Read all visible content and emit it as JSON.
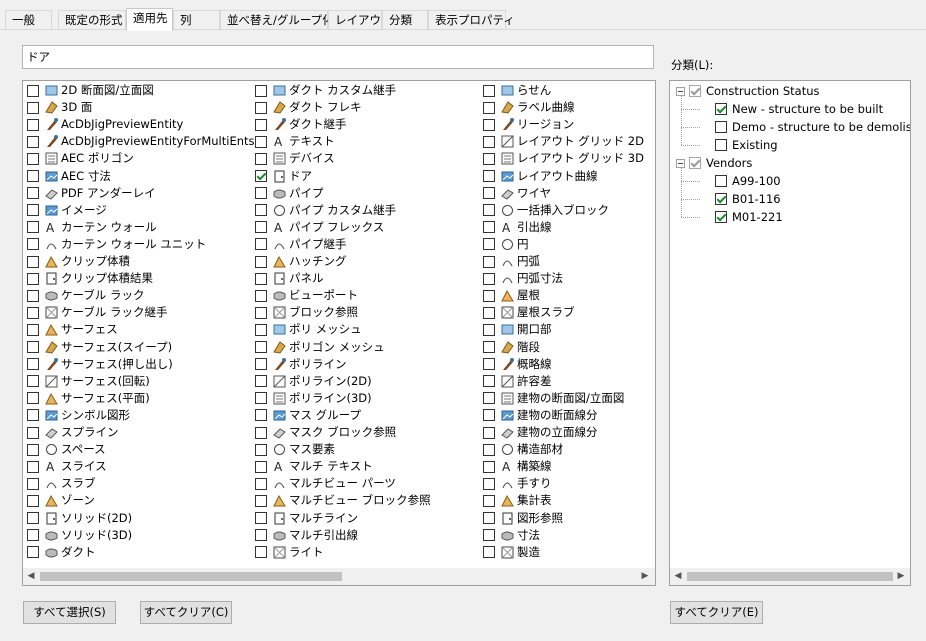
{
  "tabs": [
    "一般",
    "既定の形式",
    "適用先",
    "列",
    "並べ替え/グループ化",
    "レイアウト",
    "分類",
    "表示プロパティ"
  ],
  "active_tab": 2,
  "search": {
    "value": "ドア"
  },
  "columns": [
    [
      {
        "label": "2D 断面図/立面図",
        "icon": "section-elevation-icon",
        "checked": false
      },
      {
        "label": "3D 面",
        "icon": "3d-face-icon",
        "checked": false
      },
      {
        "label": "AcDbJigPreviewEntity",
        "icon": "brush-icon",
        "checked": false
      },
      {
        "label": "AcDbJigPreviewEntityForMultiEnts",
        "icon": "brush-icon",
        "checked": false
      },
      {
        "label": "AEC ポリゴン",
        "icon": "aec-polygon-icon",
        "checked": false
      },
      {
        "label": "AEC 寸法",
        "icon": "aec-dimension-icon",
        "checked": false
      },
      {
        "label": "PDF アンダーレイ",
        "icon": "pdf-icon",
        "checked": false
      },
      {
        "label": "イメージ",
        "icon": "image-icon",
        "checked": false
      },
      {
        "label": "カーテン ウォール",
        "icon": "curtain-wall-icon",
        "checked": false
      },
      {
        "label": "カーテン ウォール ユニット",
        "icon": "curtain-wall-unit-icon",
        "checked": false
      },
      {
        "label": "クリップ体積",
        "icon": "clip-volume-icon",
        "checked": false
      },
      {
        "label": "クリップ体積結果",
        "icon": "clip-volume-result-icon",
        "checked": false
      },
      {
        "label": "ケーブル ラック",
        "icon": "cable-tray-icon",
        "checked": false
      },
      {
        "label": "ケーブル ラック継手",
        "icon": "cable-tray-fitting-icon",
        "checked": false
      },
      {
        "label": "サーフェス",
        "icon": "surface-icon",
        "checked": false
      },
      {
        "label": "サーフェス(スイープ)",
        "icon": "surface-sweep-icon",
        "checked": false
      },
      {
        "label": "サーフェス(押し出し)",
        "icon": "surface-extrude-icon",
        "checked": false
      },
      {
        "label": "サーフェス(回転)",
        "icon": "surface-revolve-icon",
        "checked": false
      },
      {
        "label": "サーフェス(平面)",
        "icon": "surface-planar-icon",
        "checked": false
      },
      {
        "label": "シンボル図形",
        "icon": "symbol-icon",
        "checked": false
      },
      {
        "label": "スプライン",
        "icon": "spline-icon",
        "checked": false
      },
      {
        "label": "スペース",
        "icon": "space-icon",
        "checked": false
      },
      {
        "label": "スライス",
        "icon": "slice-icon",
        "checked": false
      },
      {
        "label": "スラブ",
        "icon": "slab-icon",
        "checked": false
      },
      {
        "label": "ゾーン",
        "icon": "zone-icon",
        "checked": false
      },
      {
        "label": "ソリッド(2D)",
        "icon": "solid-2d-icon",
        "checked": false
      },
      {
        "label": "ソリッド(3D)",
        "icon": "solid-3d-icon",
        "checked": false
      },
      {
        "label": "ダクト",
        "icon": "duct-icon",
        "checked": false
      }
    ],
    [
      {
        "label": "ダクト カスタム継手",
        "icon": "duct-custom-fitting-icon",
        "checked": false
      },
      {
        "label": "ダクト フレキ",
        "icon": "duct-flex-icon",
        "checked": false
      },
      {
        "label": "ダクト継手",
        "icon": "duct-fitting-icon",
        "checked": false
      },
      {
        "label": "テキスト",
        "icon": "text-icon",
        "checked": false
      },
      {
        "label": "デバイス",
        "icon": "device-icon",
        "checked": false
      },
      {
        "label": "ドア",
        "icon": "door-icon",
        "checked": true
      },
      {
        "label": "パイプ",
        "icon": "pipe-icon",
        "checked": false
      },
      {
        "label": "パイプ カスタム継手",
        "icon": "pipe-custom-fitting-icon",
        "checked": false
      },
      {
        "label": "パイプ フレックス",
        "icon": "pipe-flex-icon",
        "checked": false
      },
      {
        "label": "パイプ継手",
        "icon": "pipe-fitting-icon",
        "checked": false
      },
      {
        "label": "ハッチング",
        "icon": "hatch-icon",
        "checked": false
      },
      {
        "label": "パネル",
        "icon": "panel-icon",
        "checked": false
      },
      {
        "label": "ビューポート",
        "icon": "viewport-icon",
        "checked": false
      },
      {
        "label": "ブロック参照",
        "icon": "block-reference-icon",
        "checked": false
      },
      {
        "label": "ポリ メッシュ",
        "icon": "poly-mesh-icon",
        "checked": false
      },
      {
        "label": "ポリゴン メッシュ",
        "icon": "polygon-mesh-icon",
        "checked": false
      },
      {
        "label": "ポリライン",
        "icon": "polyline-icon",
        "checked": false
      },
      {
        "label": "ポリライン(2D)",
        "icon": "polyline-2d-icon",
        "checked": false
      },
      {
        "label": "ポリライン(3D)",
        "icon": "polyline-3d-icon",
        "checked": false
      },
      {
        "label": "マス グループ",
        "icon": "mass-group-icon",
        "checked": false
      },
      {
        "label": "マスク ブロック参照",
        "icon": "mask-block-icon",
        "checked": false
      },
      {
        "label": "マス要素",
        "icon": "mass-element-icon",
        "checked": false
      },
      {
        "label": "マルチ テキスト",
        "icon": "mtext-icon",
        "checked": false
      },
      {
        "label": "マルチビュー パーツ",
        "icon": "multiview-part-icon",
        "checked": false
      },
      {
        "label": "マルチビュー ブロック参照",
        "icon": "multiview-block-icon",
        "checked": false
      },
      {
        "label": "マルチライン",
        "icon": "multiline-icon",
        "checked": false
      },
      {
        "label": "マルチ引出線",
        "icon": "multileader-icon",
        "checked": false
      },
      {
        "label": "ライト",
        "icon": "light-icon",
        "checked": false
      }
    ],
    [
      {
        "label": "らせん",
        "icon": "helix-icon",
        "checked": false
      },
      {
        "label": "ラベル曲線",
        "icon": "label-curve-icon",
        "checked": false
      },
      {
        "label": "リージョン",
        "icon": "region-icon",
        "checked": false
      },
      {
        "label": "レイアウト グリッド 2D",
        "icon": "layout-grid-2d-icon",
        "checked": false
      },
      {
        "label": "レイアウト グリッド 3D",
        "icon": "layout-grid-3d-icon",
        "checked": false
      },
      {
        "label": "レイアウト曲線",
        "icon": "layout-curve-icon",
        "checked": false
      },
      {
        "label": "ワイヤ",
        "icon": "wire-icon",
        "checked": false
      },
      {
        "label": "一括挿入ブロック",
        "icon": "minsert-icon",
        "checked": false
      },
      {
        "label": "引出線",
        "icon": "leader-icon",
        "checked": false
      },
      {
        "label": "円",
        "icon": "circle-icon",
        "checked": false
      },
      {
        "label": "円弧",
        "icon": "arc-icon",
        "checked": false
      },
      {
        "label": "円弧寸法",
        "icon": "arc-dimension-icon",
        "checked": false
      },
      {
        "label": "屋根",
        "icon": "roof-icon",
        "checked": false
      },
      {
        "label": "屋根スラブ",
        "icon": "roof-slab-icon",
        "checked": false
      },
      {
        "label": "開口部",
        "icon": "opening-icon",
        "checked": false
      },
      {
        "label": "階段",
        "icon": "stair-icon",
        "checked": false
      },
      {
        "label": "概略線",
        "icon": "xline-icon",
        "checked": false
      },
      {
        "label": "許容差",
        "icon": "tolerance-icon",
        "checked": false
      },
      {
        "label": "建物の断面図/立面図",
        "icon": "building-section-icon",
        "checked": false
      },
      {
        "label": "建物の断面線分",
        "icon": "section-line-icon",
        "checked": false
      },
      {
        "label": "建物の立面線分",
        "icon": "elevation-line-icon",
        "checked": false
      },
      {
        "label": "構造部材",
        "icon": "structural-member-icon",
        "checked": false
      },
      {
        "label": "構築線",
        "icon": "construction-line-icon",
        "checked": false
      },
      {
        "label": "手すり",
        "icon": "railing-icon",
        "checked": false
      },
      {
        "label": "集計表",
        "icon": "schedule-table-icon",
        "checked": false
      },
      {
        "label": "図形参照",
        "icon": "shape-reference-icon",
        "checked": false
      },
      {
        "label": "寸法",
        "icon": "dimension-icon",
        "checked": false
      },
      {
        "label": "製造",
        "icon": "fabrication-icon",
        "checked": false
      }
    ]
  ],
  "buttons": {
    "select_all": "すべて選択(S)",
    "clear_all_left": "すべてクリア(C)",
    "clear_all_right": "すべてクリア(E)"
  },
  "tree": {
    "label": "分類(L):",
    "groups": [
      {
        "name": "Construction Status",
        "items": [
          {
            "name": "New - structure to be built",
            "checked": true
          },
          {
            "name": "Demo - structure to be demolished",
            "checked": false
          },
          {
            "name": "Existing",
            "checked": false
          }
        ]
      },
      {
        "name": "Vendors",
        "items": [
          {
            "name": "A99-100",
            "checked": false
          },
          {
            "name": "B01-116",
            "checked": true
          },
          {
            "name": "M01-221",
            "checked": true
          }
        ]
      }
    ]
  }
}
